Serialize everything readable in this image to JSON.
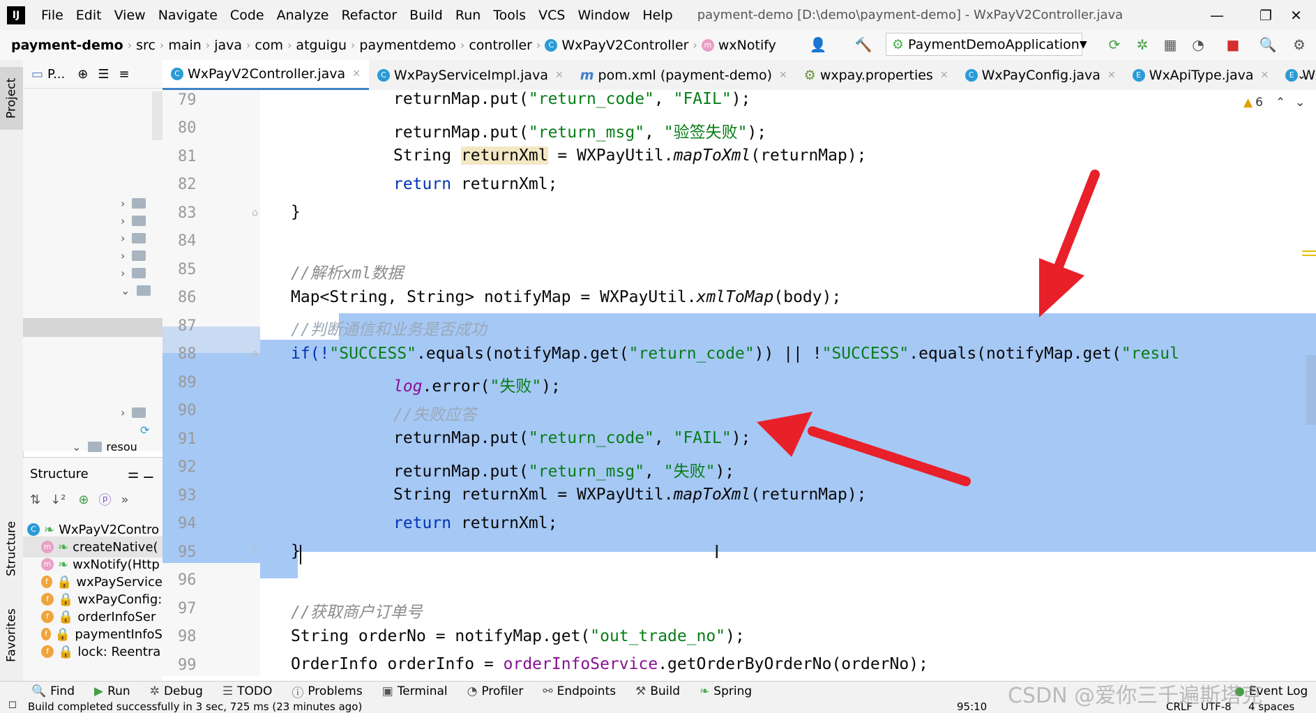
{
  "menubar": {
    "logo": "IJ",
    "items": [
      "File",
      "Edit",
      "View",
      "Navigate",
      "Code",
      "Analyze",
      "Refactor",
      "Build",
      "Run",
      "Tools",
      "VCS",
      "Window",
      "Help"
    ],
    "title": "payment-demo [D:\\demo\\payment-demo] - WxPayV2Controller.java",
    "minimize": "—",
    "restore": "❐",
    "close": "✕"
  },
  "navbar": {
    "project": "payment-demo",
    "crumbs": [
      "src",
      "main",
      "java",
      "com",
      "atguigu",
      "paymentdemo",
      "controller"
    ],
    "class_crumb": "WxPayV2Controller",
    "method_crumb": "wxNotify",
    "run_config": "PaymentDemoApplication"
  },
  "left_strip": {
    "project": "Project",
    "structure": "Structure",
    "favorites": "Favorites"
  },
  "project_panel": {
    "label": "P...",
    "resources_row": "resou"
  },
  "tabs": [
    {
      "label": "WxPayV2Controller.java",
      "icon": "C",
      "active": true
    },
    {
      "label": "WxPayServiceImpl.java",
      "icon": "C",
      "active": false
    },
    {
      "label": "pom.xml (payment-demo)",
      "icon": "m",
      "active": false
    },
    {
      "label": "wxpay.properties",
      "icon": "⚙",
      "active": false
    },
    {
      "label": "WxPayConfig.java",
      "icon": "C",
      "active": false
    },
    {
      "label": "WxApiType.java",
      "icon": "E",
      "active": false
    },
    {
      "label": "WxNo",
      "icon": "E",
      "active": false
    }
  ],
  "editor": {
    "warnings": "6",
    "line_numbers": [
      "79",
      "80",
      "81",
      "82",
      "83",
      "84",
      "85",
      "86",
      "87",
      "88",
      "89",
      "90",
      "91",
      "92",
      "93",
      "94",
      "95",
      "96",
      "97",
      "98",
      "99"
    ]
  },
  "code": {
    "l79_a": "returnMap.put(",
    "l79_s1": "\"return_code\"",
    "l79_b": ", ",
    "l79_s2": "\"FAIL\"",
    "l79_c": ");",
    "l80_a": "returnMap.put(",
    "l80_s1": "\"return_msg\"",
    "l80_b": ", ",
    "l80_s2": "\"验签失败\"",
    "l80_c": ");",
    "l81_a": "String ",
    "l81_var": "returnXml",
    "l81_b": " = WXPayUtil.",
    "l81_m": "mapToXml",
    "l81_c": "(returnMap);",
    "l82_kw": "return",
    "l82_b": " returnXml;",
    "l83": "}",
    "l85": "//解析xml数据",
    "l86_a": "Map<String, String> notifyMap = WXPayUtil.",
    "l86_m": "xmlToMap",
    "l86_b": "(body);",
    "l87": "//判断通信和业务是否成功",
    "l88_a": "if(!",
    "l88_s1": "\"SUCCESS\"",
    "l88_b": ".equals(notifyMap.get(",
    "l88_s2": "\"return_code\"",
    "l88_c": ")) || !",
    "l88_s3": "\"SUCCESS\"",
    "l88_d": ".equals(notifyMap.get(",
    "l88_s4": "\"resul",
    "l89_f": "log",
    "l89_a": ".error(",
    "l89_s": "\"失败\"",
    "l89_b": ");",
    "l90": "//失败应答",
    "l91_a": "returnMap.put(",
    "l91_s1": "\"return_code\"",
    "l91_b": ", ",
    "l91_s2": "\"FAIL\"",
    "l91_c": ");",
    "l92_a": "returnMap.put(",
    "l92_s1": "\"return_msg\"",
    "l92_b": ", ",
    "l92_s2": "\"失败\"",
    "l92_c": ");",
    "l93_a": "String returnXml = WXPayUtil.",
    "l93_m": "mapToXml",
    "l93_b": "(returnMap);",
    "l94_kw": "return",
    "l94_b": " returnXml;",
    "l95": "}",
    "l97": "//获取商户订单号",
    "l98_a": "String orderNo = notifyMap.get(",
    "l98_s": "\"out_trade_no\"",
    "l98_b": ");",
    "l99_a": "OrderInfo orderInfo = ",
    "l99_f": "orderInfoService",
    "l99_b": ".getOrderByOrderNo(orderNo);"
  },
  "structure_panel": {
    "title": "Structure",
    "root": "WxPayV2Contro",
    "items": [
      {
        "icon": "m",
        "label": "createNative("
      },
      {
        "icon": "m",
        "label": "wxNotify(Http"
      },
      {
        "icon": "f",
        "label": "wxPayService"
      },
      {
        "icon": "f",
        "label": "wxPayConfig:"
      },
      {
        "icon": "f",
        "label": "orderInfoSer"
      },
      {
        "icon": "f",
        "label": "paymentInfoS"
      },
      {
        "icon": "f",
        "label": "lock: Reentra"
      }
    ]
  },
  "bottom_bar": {
    "items": [
      "Find",
      "Run",
      "Debug",
      "TODO",
      "Problems",
      "Terminal",
      "Profiler",
      "Endpoints",
      "Build",
      "Spring"
    ],
    "event_log": "Event Log"
  },
  "status_bar": {
    "message": "Build completed successfully in 3 sec, 725 ms (23 minutes ago)",
    "position": "95:10",
    "line_sep": "CRLF",
    "encoding": "UTF-8",
    "indent": "4 spaces"
  },
  "watermark": "CSDN @爱你三千遍斯塔克",
  "colors": {
    "selection": "#a6c8f5",
    "arrow": "#e8202a",
    "keyword": "#0033b3",
    "string": "#067d17",
    "comment": "#8c8c8c"
  }
}
